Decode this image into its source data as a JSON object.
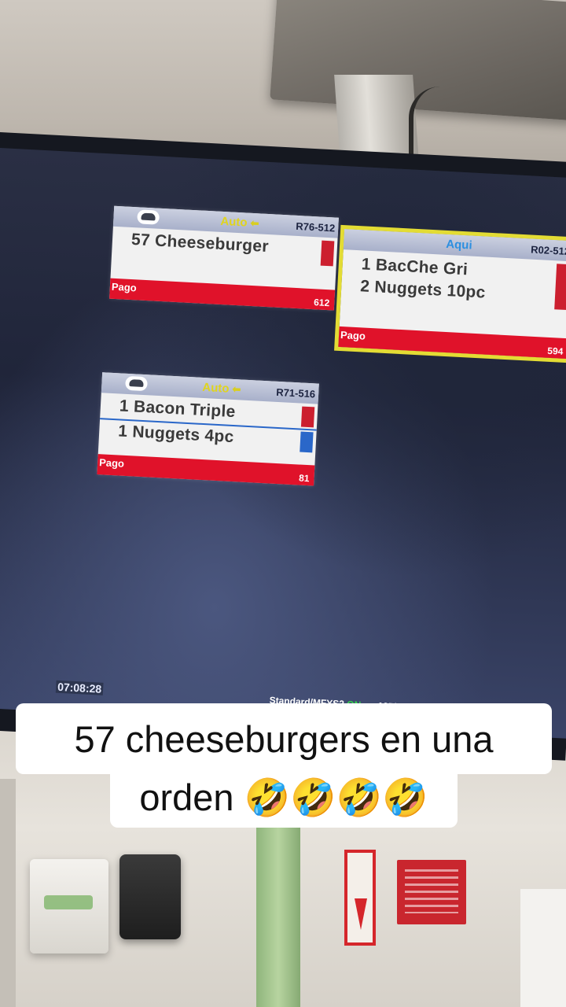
{
  "kitchen_display": {
    "orders": [
      {
        "mode": "Auto",
        "register": "R76-512",
        "items": [
          "57 Cheeseburger"
        ],
        "payment": "Pago",
        "number": "612",
        "active": false
      },
      {
        "mode": "Aqui",
        "register": "R02-512",
        "items": [
          "1 BacChe Gri",
          "2 Nuggets 10pc"
        ],
        "payment": "Pago",
        "number": "594",
        "active": true
      },
      {
        "mode": "Auto",
        "register": "R71-516",
        "items": [
          "1 Bacon Triple",
          "1 Nuggets 4pc"
        ],
        "payment": "Pago",
        "number": "81",
        "active": false
      }
    ],
    "clock": "07:08:28",
    "status": {
      "mode": "Standard/MFYS2",
      "state": "ON",
      "count": "135/128"
    }
  },
  "caption": {
    "line1": "57 cheeseburgers en una",
    "line2": "orden 🤣🤣🤣🤣"
  },
  "colors": {
    "ticket_red": "#e0122a",
    "auto_yellow": "#e0d41e",
    "aqui_blue": "#2c8fe0",
    "active_border": "#e3dc34",
    "status_on": "#35d64c"
  }
}
